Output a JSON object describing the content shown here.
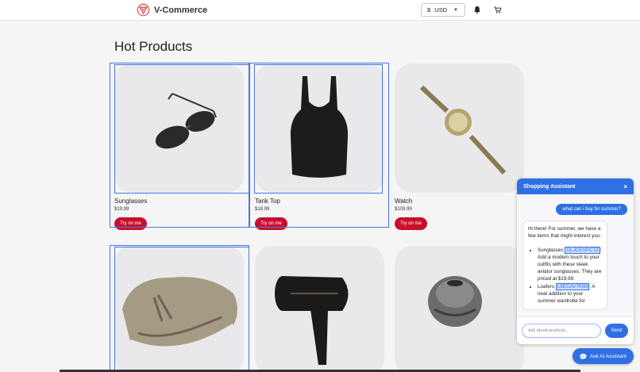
{
  "header": {
    "brand": "V-Commerce",
    "currency": {
      "symbol": "$",
      "code": "USD"
    },
    "icons": [
      "bell-icon",
      "cart-icon",
      "logo-icon",
      "chevron-down-icon"
    ]
  },
  "section": {
    "title": "Hot Products"
  },
  "products": [
    {
      "name": "Sunglasses",
      "price": "$19.99",
      "button": "Try on me"
    },
    {
      "name": "Tank Top",
      "price": "$18.99",
      "button": "Try on me"
    },
    {
      "name": "Watch",
      "price": "$109.99",
      "button": "Try on me"
    },
    {
      "name": "",
      "price": "",
      "button": ""
    },
    {
      "name": "",
      "price": "",
      "button": ""
    },
    {
      "name": "",
      "price": "",
      "button": ""
    }
  ],
  "chat": {
    "title": "Shopping Assistant",
    "close": "×",
    "user_message": "what can i buy for summer?",
    "bot_intro": "Hi there! For summer, we have a few items that might interest you:",
    "bot_items": [
      {
        "name": "Sunglasses",
        "code": "OLJCESPC7Z",
        "text": ": Add a modern touch to your outfits with these sleek aviator sunglasses. They are priced at $19.99."
      },
      {
        "name": "Loafers",
        "code": "L9ECAV7KIM",
        "text": ": A neat addition to your summer wardrobe for"
      }
    ],
    "input_placeholder": "Ask about products...",
    "send_label": "Send"
  },
  "ask_ai": {
    "label": "Ask AI Assistant"
  },
  "colors": {
    "accent": "#2f6fe4",
    "button": "#c8102e",
    "brand": "#c8102e"
  }
}
